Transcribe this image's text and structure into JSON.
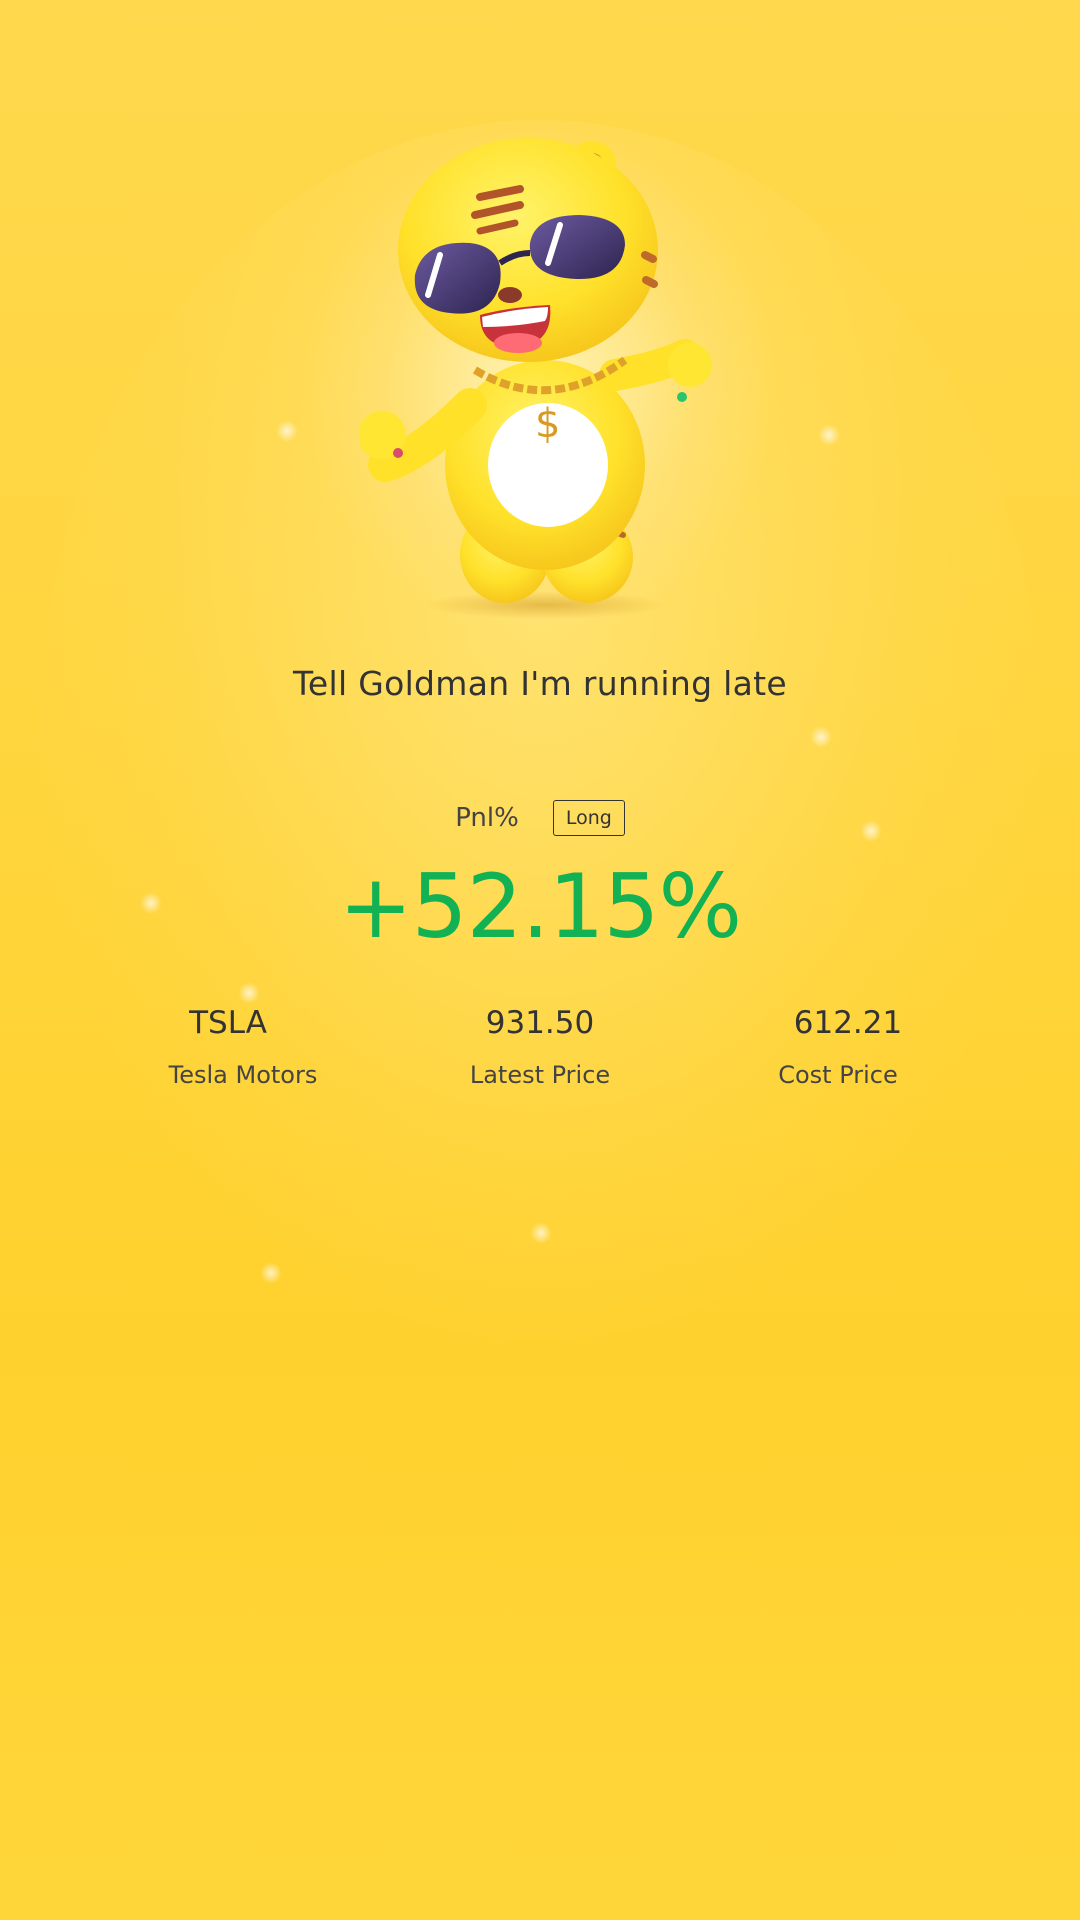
{
  "headline": "Tell Goldman I'm running late",
  "pnl": {
    "label": "Pnl%",
    "direction": "Long",
    "value": "+52.15%",
    "value_color": "#12b254"
  },
  "stats": [
    {
      "value": "TSLA",
      "label": "Tesla Motors"
    },
    {
      "value": "931.50",
      "label": "Latest Price"
    },
    {
      "value": "612.21",
      "label": "Cost Price"
    }
  ],
  "mascot": {
    "icon": "tiger-mascot-sunglasses-icon"
  },
  "colors": {
    "background": "#ffd63f",
    "text": "#333333",
    "profit": "#12b254"
  }
}
